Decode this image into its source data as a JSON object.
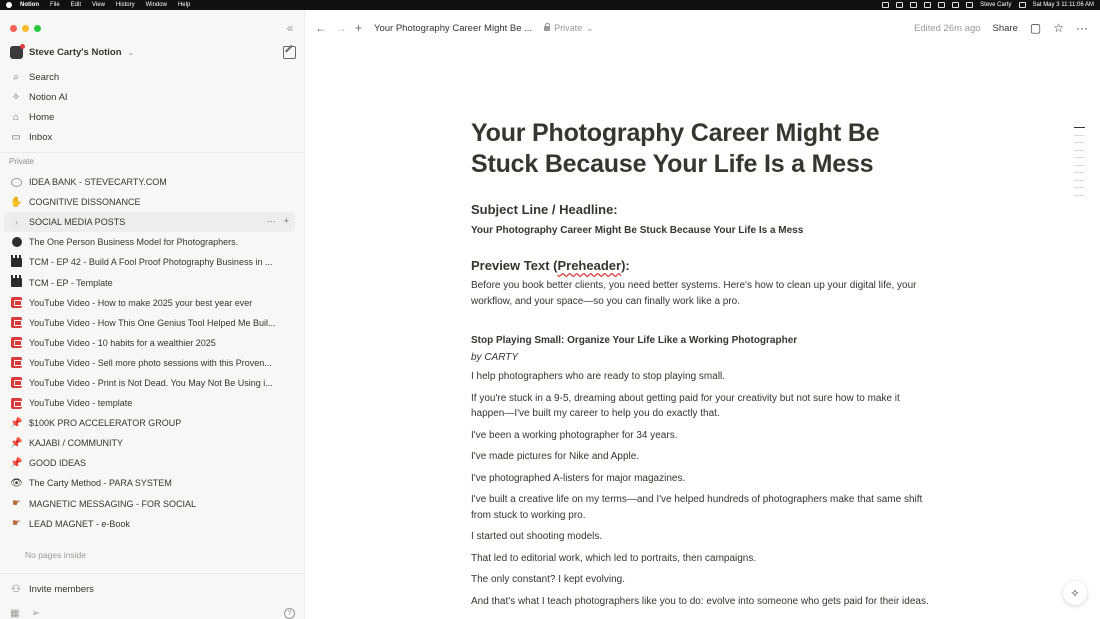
{
  "menubar": {
    "app_name": "Notion",
    "menus": [
      "File",
      "Edit",
      "View",
      "History",
      "Window",
      "Help"
    ],
    "user": "Steve Carty",
    "datetime": "Sat May 3  11:11:06 AM"
  },
  "sidebar": {
    "workspace_name": "Steve Carty's Notion",
    "nav": [
      {
        "label": "Search",
        "icon": "search-icon"
      },
      {
        "label": "Notion AI",
        "icon": "notion-ai-icon"
      },
      {
        "label": "Home",
        "icon": "home-icon"
      },
      {
        "label": "Inbox",
        "icon": "inbox-icon"
      }
    ],
    "section_label": "Private",
    "pages": [
      {
        "title": "IDEA BANK - STEVECARTY.COM",
        "icon": "speech-bubble-icon"
      },
      {
        "title": "COGNITIVE DISSONANCE",
        "icon": "raised-hand-icon"
      },
      {
        "title": "SOCIAL MEDIA POSTS",
        "icon": "chevron-right-icon"
      },
      {
        "title": "The One Person Business Model for Photographers.",
        "icon": "bomb-icon"
      },
      {
        "title": "TCM - EP 42 - Build A Fool Proof Photography Business in ...",
        "icon": "clapperboard-icon"
      },
      {
        "title": "TCM - EP - Template",
        "icon": "clapperboard-icon"
      },
      {
        "title": "YouTube Video - How to make 2025 your best year ever",
        "icon": "youtube-icon"
      },
      {
        "title": "YouTube Video - How This One Genius Tool Helped Me Buil...",
        "icon": "youtube-icon"
      },
      {
        "title": "YouTube Video - 10 habits for a wealthier 2025",
        "icon": "youtube-icon"
      },
      {
        "title": "YouTube Video - Sell more photo sessions with this Proven...",
        "icon": "youtube-icon"
      },
      {
        "title": "YouTube Video - Print is Not Dead. You May Not Be Using i...",
        "icon": "youtube-icon"
      },
      {
        "title": "YouTube Video - template",
        "icon": "youtube-icon"
      },
      {
        "title": "$100K PRO ACCELERATOR GROUP",
        "icon": "pushpin-icon"
      },
      {
        "title": "KAJABI / COMMUNITY",
        "icon": "pushpin-icon"
      },
      {
        "title": "GOOD IDEAS",
        "icon": "pushpin-icon"
      },
      {
        "title": "The Carty Method - PARA SYSTEM",
        "icon": "eye-icon"
      },
      {
        "title": "MAGNETIC MESSAGING - FOR SOCIAL",
        "icon": "pointing-hand-icon"
      },
      {
        "title": "LEAD MAGNET - e-Book",
        "icon": "pointing-hand-icon"
      }
    ],
    "no_pages_text": "No pages inside",
    "invite_label": "Invite members"
  },
  "topbar": {
    "breadcrumb_title": "Your Photography Career Might Be ...",
    "privacy": "Private",
    "edited": "Edited 26m ago",
    "share_label": "Share"
  },
  "document": {
    "title": "Your Photography Career Might Be Stuck Because Your Life Is a Mess",
    "subject_heading": "Subject Line / Headline:",
    "subject_text": "Your Photography Career Might Be Stuck Because Your Life Is a Mess",
    "preview_heading_prefix": "Preview Text (",
    "preview_heading_word": "Preheader",
    "preview_heading_suffix": "):",
    "preview_text": "Before you book better clients, you need better systems. Here's how to clean up your digital life, your workflow, and your space—so you can finally work like a pro.",
    "section_title": "Stop Playing Small: Organize Your Life Like a Working Photographer",
    "byline": "by CARTY",
    "paragraphs": [
      "I help photographers who are ready to stop playing small.",
      "If you're stuck in a 9-5, dreaming about getting paid for your creativity but not sure how to make it happen—I've built my career to help you do exactly that.",
      "I've been a working photographer for 34 years.",
      "I've made pictures for Nike and Apple.",
      "I've photographed A-listers for major magazines.",
      "I've built a creative life on my terms—and I've helped hundreds of photographers make that same shift from stuck to working pro.",
      "I started out shooting models.",
      "That led to editorial work, which led to portraits, then campaigns.",
      "The only constant? I kept evolving.",
      "And that's what I teach photographers like you to do: evolve into someone who gets paid for their ideas."
    ]
  }
}
